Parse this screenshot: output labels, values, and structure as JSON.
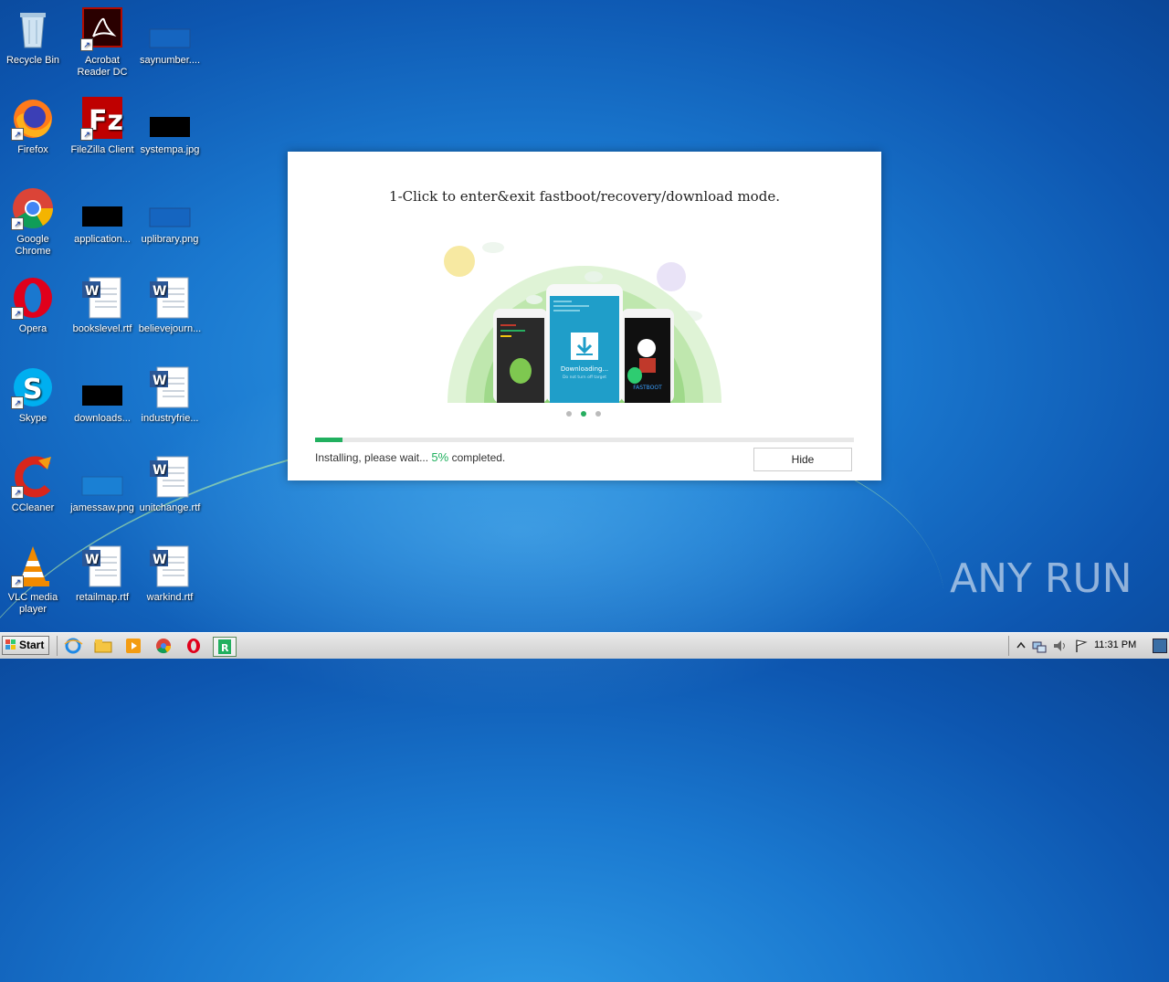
{
  "desktop": {
    "icons": [
      {
        "label": "Recycle Bin"
      },
      {
        "label": "Acrobat Reader DC"
      },
      {
        "label": "saynumber...."
      },
      {
        "label": "Firefox"
      },
      {
        "label": "FileZilla Client"
      },
      {
        "label": "systempa.jpg"
      },
      {
        "label": "Google Chrome"
      },
      {
        "label": "application..."
      },
      {
        "label": "uplibrary.png"
      },
      {
        "label": "Opera"
      },
      {
        "label": "bookslevel.rtf"
      },
      {
        "label": "believejourn..."
      },
      {
        "label": "Skype"
      },
      {
        "label": "downloads..."
      },
      {
        "label": "industryfrie..."
      },
      {
        "label": "CCleaner"
      },
      {
        "label": "jamessaw.png"
      },
      {
        "label": "unitchange.rtf"
      },
      {
        "label": "VLC media player"
      },
      {
        "label": "retailmap.rtf"
      },
      {
        "label": "warkind.rtf"
      }
    ]
  },
  "installer": {
    "title": "1-Click to enter&exit fastboot/recovery/download mode.",
    "illustration": {
      "center_phone_text": "Downloading...",
      "center_phone_subtext": "Do not turn off target",
      "right_phone_text": "FASTBOOT"
    },
    "progress": {
      "percent": 5
    },
    "status_prefix": "Installing, please wait...",
    "status_percent": "5%",
    "status_suffix": "completed.",
    "hide_label": "Hide",
    "carousel": {
      "count": 3,
      "active_index": 1
    }
  },
  "watermark": {
    "text": "ANY RUN"
  },
  "taskbar": {
    "start_label": "Start",
    "clock": "11:31 PM"
  },
  "colors": {
    "accent_green": "#21b05f",
    "desktop_blue": "#1a78cf"
  }
}
